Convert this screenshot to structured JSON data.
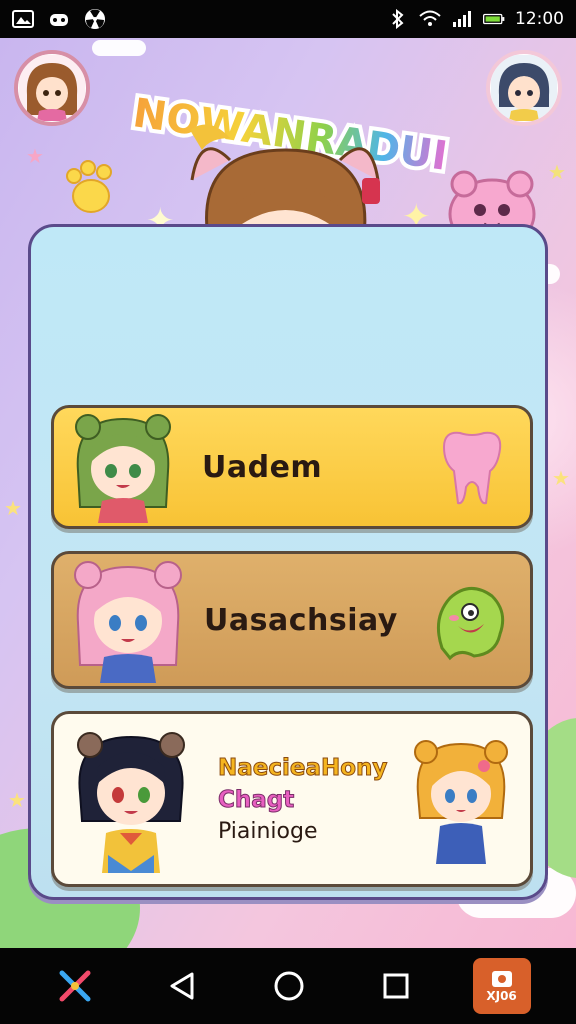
{
  "status_bar": {
    "time": "12:00",
    "icons": [
      "gallery-icon",
      "game-controller-icon",
      "radioactive-icon",
      "bluetooth-icon",
      "wifi-icon",
      "signal-icon",
      "battery-icon"
    ]
  },
  "title": "NOWANRADUI",
  "menu": {
    "item1": "Uadem",
    "item2": "Uasachsiay",
    "item3_line1": "NaecieaHony",
    "item3_line2": "Chagt",
    "item3_line3": "Piainioge"
  },
  "nav": {
    "app_label": "XJ06"
  },
  "colors": {
    "status_bg": "#050505",
    "panel_bg": "#bfe8f7",
    "yellow_card": "#f8c335",
    "tan_card": "#cf9b58",
    "cream_card": "#fffbee",
    "nav_app": "#d8602a"
  }
}
